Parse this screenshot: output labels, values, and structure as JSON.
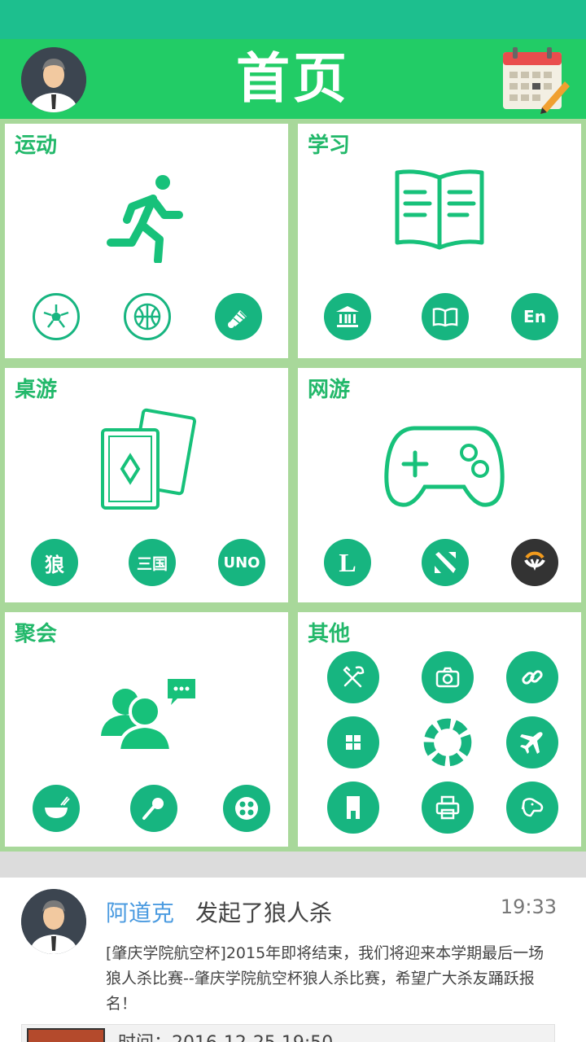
{
  "header": {
    "title": "首页"
  },
  "tiles": [
    {
      "label": "运动",
      "icon": "running-person-icon",
      "items": [
        {
          "name": "soccer-ball-icon"
        },
        {
          "name": "basketball-icon"
        },
        {
          "name": "badminton-icon"
        }
      ]
    },
    {
      "label": "学习",
      "icon": "open-book-icon",
      "items": [
        {
          "name": "library-icon"
        },
        {
          "name": "reading-icon"
        },
        {
          "name": "english-icon",
          "text": "En"
        }
      ]
    },
    {
      "label": "桌游",
      "icon": "playing-cards-icon",
      "items": [
        {
          "name": "werewolf-icon",
          "text": "狼"
        },
        {
          "name": "three-kingdoms-icon",
          "text": "三国"
        },
        {
          "name": "uno-icon",
          "text": "UNO"
        }
      ]
    },
    {
      "label": "网游",
      "icon": "gamepad-icon",
      "items": [
        {
          "name": "league-of-legends-icon",
          "text": "L"
        },
        {
          "name": "dota-icon"
        },
        {
          "name": "overwatch-icon"
        }
      ]
    },
    {
      "label": "聚会",
      "icon": "people-chat-icon",
      "items": [
        {
          "name": "food-bowl-icon"
        },
        {
          "name": "karaoke-mic-icon"
        },
        {
          "name": "film-reel-icon"
        }
      ]
    },
    {
      "label": "其他",
      "items": [
        {
          "name": "tools-icon"
        },
        {
          "name": "camera-icon"
        },
        {
          "name": "link-icon"
        },
        {
          "name": "windows-icon"
        },
        {
          "name": "ring-icon"
        },
        {
          "name": "airplane-icon"
        },
        {
          "name": "bookmark-icon"
        },
        {
          "name": "printer-icon"
        },
        {
          "name": "pet-icon"
        }
      ]
    }
  ],
  "feed": {
    "user": "阿道克",
    "action": "发起了狼人杀",
    "time": "19:33",
    "body": "[肇庆学院航空杯]2015年即将结束，我们将迎来本学期最后一场狼人杀比赛--肇庆学院航空杯狼人杀比赛，希望广大杀友踊跃报名！",
    "event_time": "时间：2016-12-25 19:50"
  },
  "colors": {
    "primary": "#22cc66",
    "status_bar": "#1dbf8e",
    "accent": "#17b580",
    "grid": "#a8d89a",
    "user_link": "#4b9be0"
  }
}
